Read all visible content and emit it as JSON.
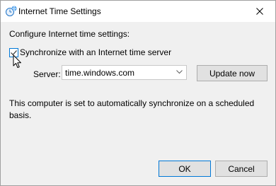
{
  "window": {
    "title": "Internet Time Settings",
    "icon": "clock-globe-icon",
    "close_icon": "close-icon"
  },
  "content": {
    "heading": "Configure Internet time settings:",
    "sync_checkbox": {
      "label": "Synchronize with an Internet time server",
      "checked": true
    },
    "server": {
      "label": "Server:",
      "value": "time.windows.com"
    },
    "update_button": "Update now",
    "info": "This computer is set to automatically synchronize on a scheduled basis."
  },
  "buttons": {
    "ok": "OK",
    "cancel": "Cancel"
  },
  "colors": {
    "accent": "#0078d7",
    "content_bg": "#f0f0f0",
    "button_bg": "#e1e1e1"
  }
}
